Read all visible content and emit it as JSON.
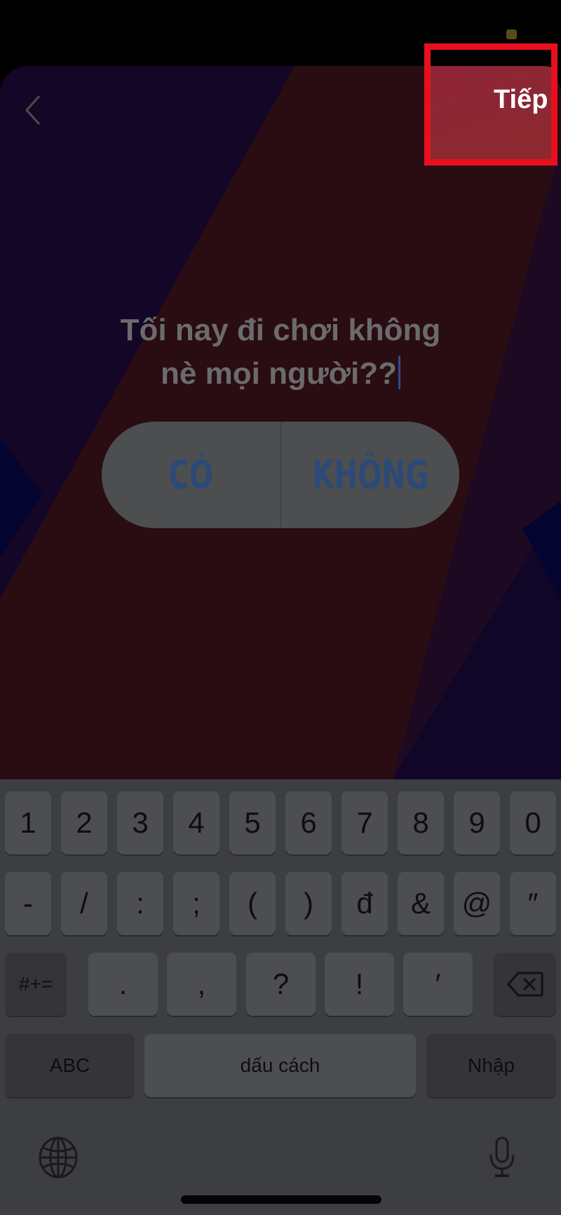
{
  "app": {
    "next_button": "Tiếp",
    "question_line1": "Tối nay đi chơi không",
    "question_line2": "nè mọi người??",
    "poll_options": [
      "CÓ",
      "KHÔNG"
    ]
  },
  "colors": {
    "highlight_box": "#e8101e",
    "poll_text": "#2c4a78",
    "next_button_bg": "#8e2437"
  },
  "keyboard": {
    "row1": [
      "1",
      "2",
      "3",
      "4",
      "5",
      "6",
      "7",
      "8",
      "9",
      "0"
    ],
    "row2": [
      "-",
      "/",
      ":",
      ";",
      "(",
      ")",
      "đ",
      "&",
      "@",
      "″"
    ],
    "row3_left": "#+=",
    "row3": [
      ".",
      ",",
      "?",
      "!",
      "′"
    ],
    "abc": "ABC",
    "space": "dấu cách",
    "enter": "Nhập"
  }
}
